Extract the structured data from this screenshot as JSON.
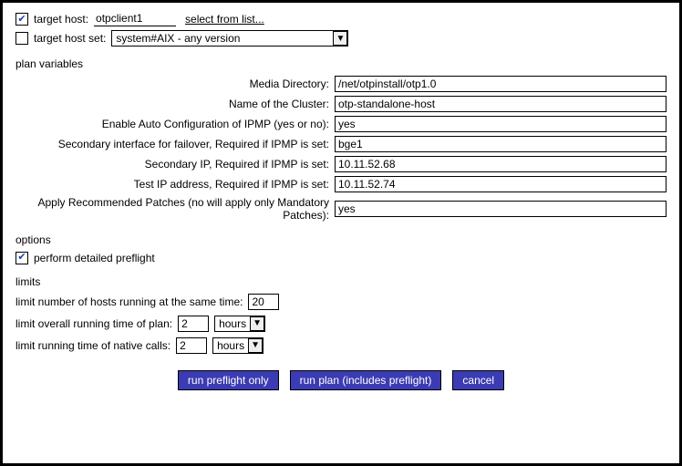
{
  "target": {
    "host_label": "target host:",
    "host_value": "otpclient1",
    "select_link": "select from list...",
    "host_checked": true,
    "hostset_label": "target host set:",
    "hostset_value": "system#AIX - any version",
    "hostset_checked": false
  },
  "sections": {
    "plan_vars": "plan variables",
    "options": "options",
    "limits": "limits"
  },
  "vars": [
    {
      "label": "Media Directory:",
      "value": "/net/otpinstall/otp1.0"
    },
    {
      "label": "Name of the Cluster:",
      "value": "otp-standalone-host"
    },
    {
      "label": "Enable Auto Configuration of IPMP (yes or no):",
      "value": "yes"
    },
    {
      "label": "Secondary interface for failover, Required if IPMP is set:",
      "value": "bge1"
    },
    {
      "label": "Secondary IP, Required if IPMP is set:",
      "value": "10.11.52.68"
    },
    {
      "label": "Test IP address, Required if IPMP is set:",
      "value": "10.11.52.74"
    },
    {
      "label": "Apply Recommended Patches (no will apply only Mandatory Patches):",
      "value": "yes"
    }
  ],
  "options": {
    "preflight_label": "perform detailed preflight",
    "preflight_checked": true
  },
  "limits": {
    "hosts_label": "limit number of hosts running at the same time:",
    "hosts_value": "20",
    "plan_time_label": "limit overall running time of plan:",
    "plan_time_value": "2",
    "plan_time_unit": "hours",
    "native_time_label": "limit running time of native calls:",
    "native_time_value": "2",
    "native_time_unit": "hours"
  },
  "buttons": {
    "preflight": "run preflight only",
    "run_plan": "run plan (includes preflight)",
    "cancel": "cancel"
  },
  "glyphs": {
    "check": "✔",
    "down": "▼"
  }
}
